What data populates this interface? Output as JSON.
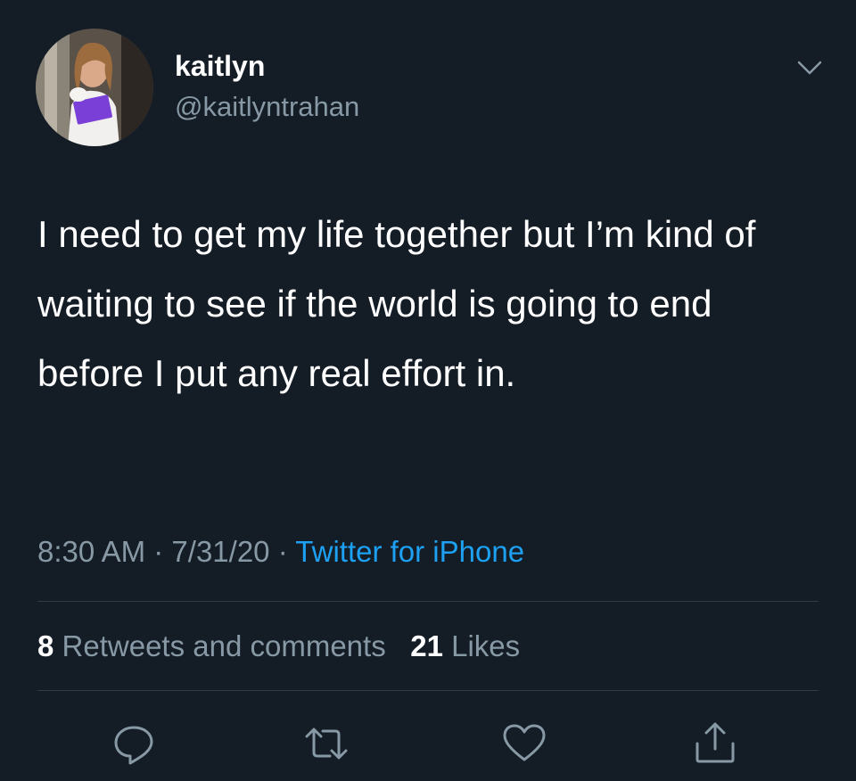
{
  "author": {
    "display_name": "kaitlyn",
    "handle": "@kaitlyntrahan"
  },
  "tweet": {
    "text": "I need to get my life together but I’m kind of waiting to see if the world is going to end before I put any real effort in.",
    "time": "8:30 AM",
    "separator": "·",
    "date": "7/31/20",
    "source": "Twitter for iPhone"
  },
  "stats": {
    "retweets_count": "8",
    "retweets_label": "Retweets and comments",
    "likes_count": "21",
    "likes_label": "Likes"
  },
  "icons": {
    "menu": "chevron-down-icon",
    "reply": "reply-icon",
    "retweet": "retweet-icon",
    "like": "heart-icon",
    "share": "share-icon"
  },
  "colors": {
    "background": "#141c26",
    "text_primary": "#ffffff",
    "text_secondary": "#8899a6",
    "link": "#1da1f2",
    "divider": "#2f3b47"
  }
}
